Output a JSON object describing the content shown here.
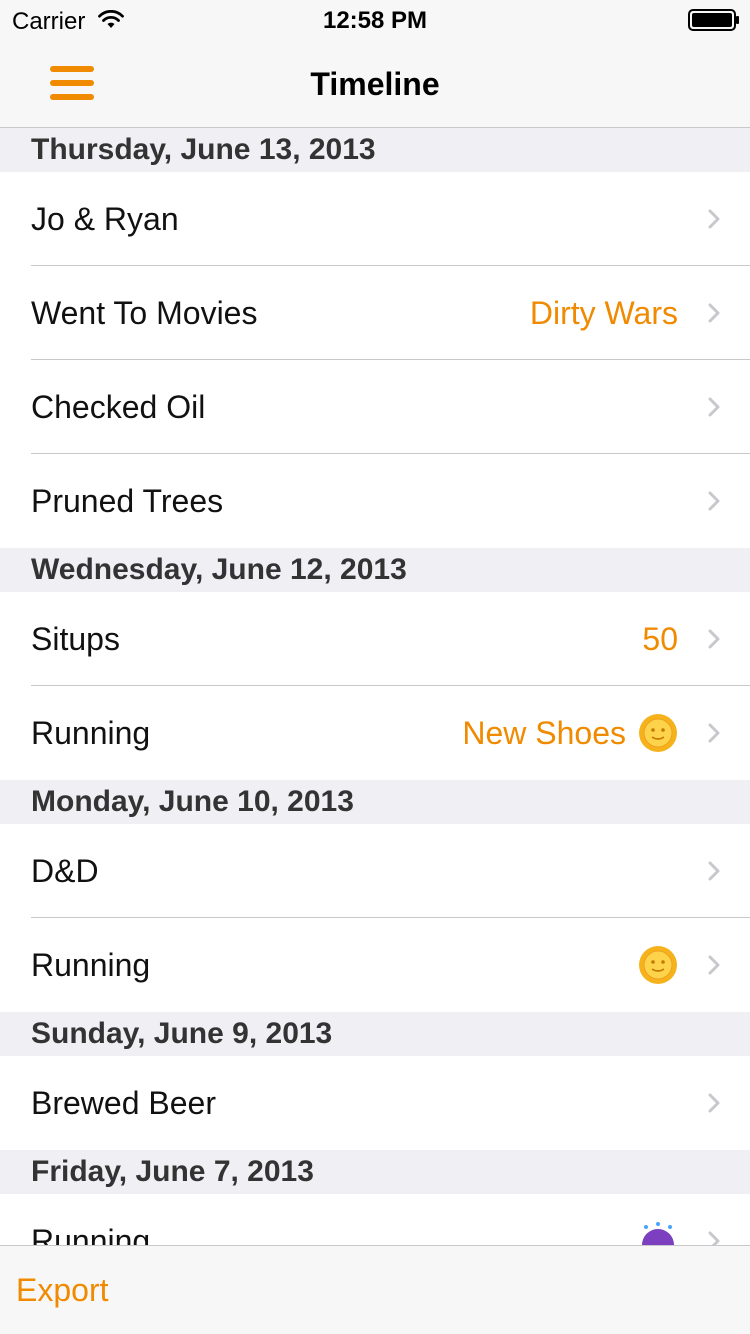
{
  "status_bar": {
    "carrier": "Carrier",
    "time": "12:58 PM",
    "wifi_icon": "wifi-icon",
    "battery_icon": "battery-icon"
  },
  "nav": {
    "title": "Timeline",
    "menu_icon": "hamburger-menu-icon"
  },
  "colors": {
    "accent": "#f08a00",
    "section_background": "#efeff4",
    "separator": "#c8c7cc",
    "bar_background": "#f7f7f7"
  },
  "sections": [
    {
      "date": "Thursday, June 13, 2013",
      "items": [
        {
          "title": "Jo & Ryan",
          "detail": "",
          "icon": ""
        },
        {
          "title": "Went To Movies",
          "detail": "Dirty Wars",
          "icon": ""
        },
        {
          "title": "Checked Oil",
          "detail": "",
          "icon": ""
        },
        {
          "title": "Pruned Trees",
          "detail": "",
          "icon": ""
        }
      ]
    },
    {
      "date": "Wednesday, June 12, 2013",
      "items": [
        {
          "title": "Situps",
          "detail": "50",
          "icon": ""
        },
        {
          "title": "Running",
          "detail": "New Shoes",
          "icon": "sun-with-face-icon"
        }
      ]
    },
    {
      "date": "Monday, June 10, 2013",
      "items": [
        {
          "title": "D&D",
          "detail": "",
          "icon": ""
        },
        {
          "title": "Running",
          "detail": "",
          "icon": "sun-with-face-icon"
        }
      ]
    },
    {
      "date": "Sunday, June 9, 2013",
      "items": [
        {
          "title": "Brewed Beer",
          "detail": "",
          "icon": ""
        }
      ]
    },
    {
      "date": "Friday, June 7, 2013",
      "items": [
        {
          "title": "Running",
          "detail": "",
          "icon": "umbrella-with-rain-icon"
        }
      ]
    }
  ],
  "toolbar": {
    "export_label": "Export"
  }
}
